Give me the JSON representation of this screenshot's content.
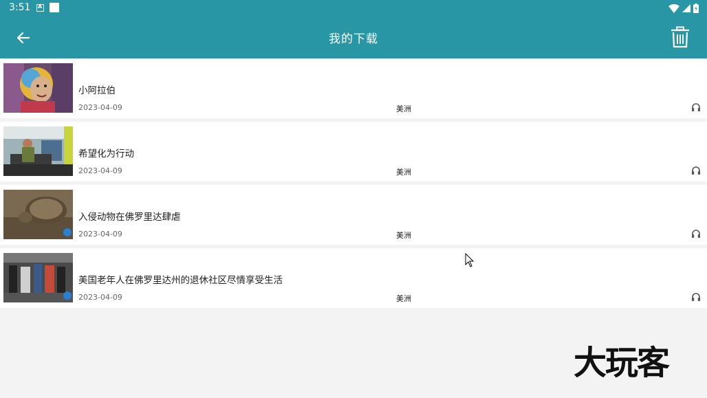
{
  "status_bar": {
    "time": "3:51"
  },
  "app_bar": {
    "title": "我的下载"
  },
  "downloads": [
    {
      "title": "小阿拉伯",
      "date": "2023-04-09",
      "category": "美洲"
    },
    {
      "title": "希望化为行动",
      "date": "2023-04-09",
      "category": "美洲"
    },
    {
      "title": "入侵动物在佛罗里达肆虐",
      "date": "2023-04-09",
      "category": "美洲"
    },
    {
      "title": "美国老年人在佛罗里达州的退休社区尽情享受生活",
      "date": "2023-04-09",
      "category": "美洲"
    }
  ],
  "watermark": {
    "text": "大玩客"
  },
  "colors": {
    "primary": "#2896a5",
    "background": "#f3f3f3",
    "row": "#ffffff"
  },
  "icons": [
    "back-arrow-icon",
    "trash-icon",
    "headphones-icon",
    "wifi-icon",
    "signal-icon",
    "battery-icon"
  ]
}
